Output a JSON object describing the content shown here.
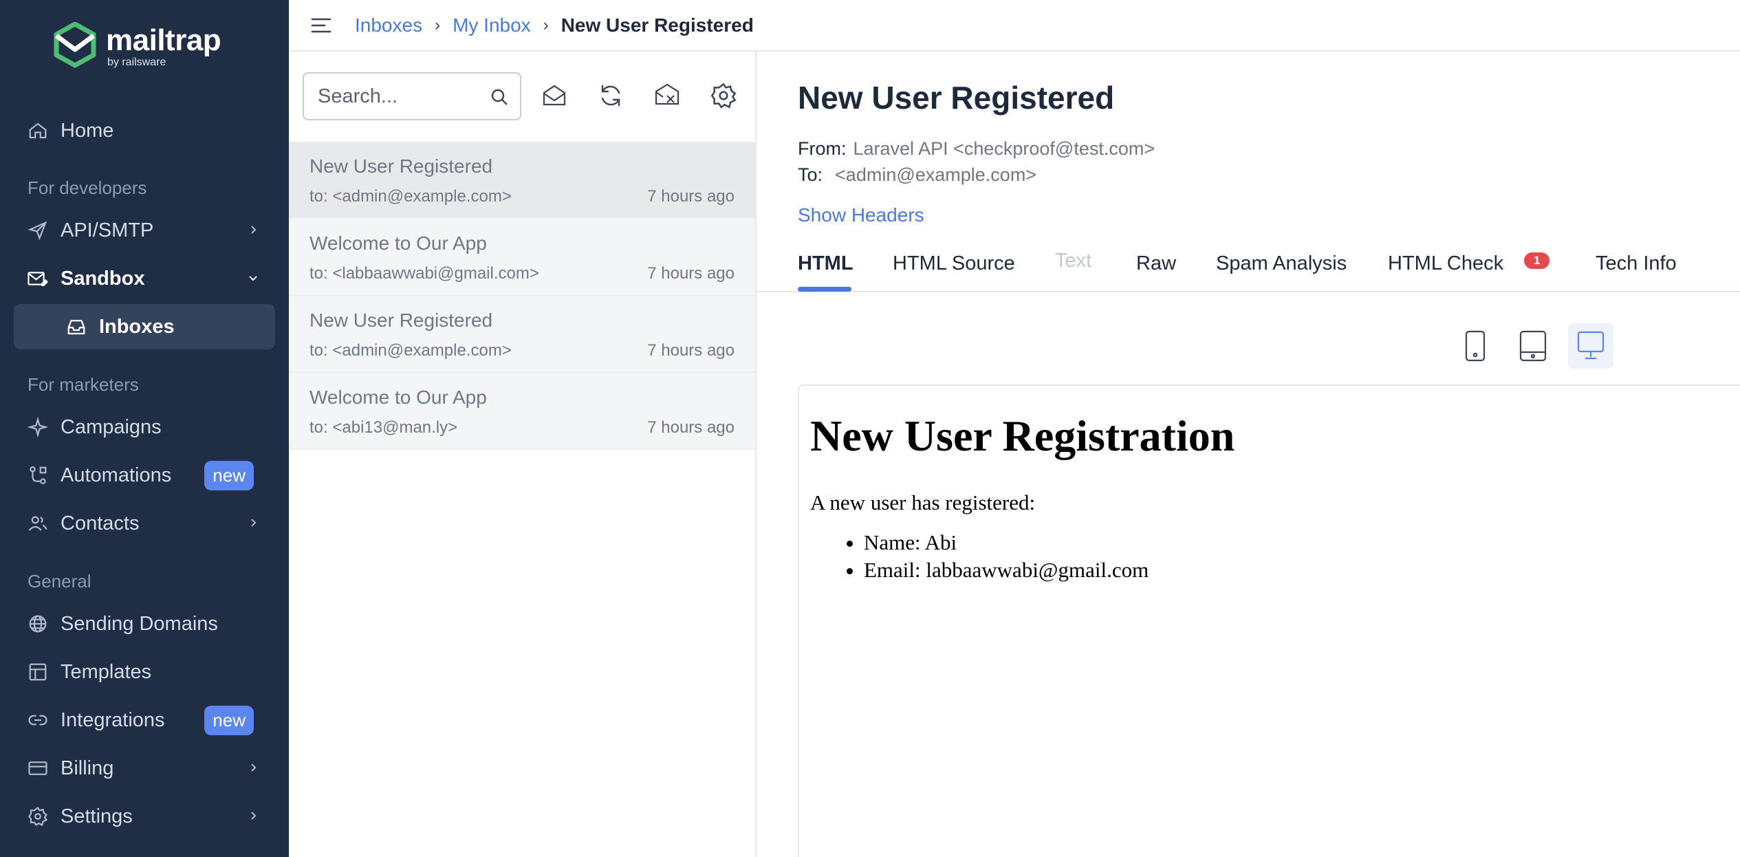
{
  "brand": {
    "name": "mailtrap",
    "sub": "by railsware",
    "accent": "#4dbd74"
  },
  "sidebar": {
    "home": "Home",
    "section_dev": "For developers",
    "api_smtp": "API/SMTP",
    "sandbox": "Sandbox",
    "inboxes": "Inboxes",
    "section_marketers": "For marketers",
    "campaigns": "Campaigns",
    "automations": "Automations",
    "automations_badge": "new",
    "contacts": "Contacts",
    "section_general": "General",
    "sending_domains": "Sending Domains",
    "templates": "Templates",
    "integrations": "Integrations",
    "integrations_badge": "new",
    "billing": "Billing",
    "settings": "Settings"
  },
  "breadcrumb": {
    "root": "Inboxes",
    "inbox": "My Inbox",
    "current": "New User Registered",
    "sep": "›"
  },
  "search": {
    "placeholder": "Search..."
  },
  "messages": [
    {
      "subject": "New User Registered",
      "to": "to: <admin@example.com>",
      "time": "7 hours ago"
    },
    {
      "subject": "Welcome to Our App",
      "to": "to: <labbaawwabi@gmail.com>",
      "time": "7 hours ago"
    },
    {
      "subject": "New User Registered",
      "to": "to: <admin@example.com>",
      "time": "7 hours ago"
    },
    {
      "subject": "Welcome to Our App",
      "to": "to: <abi13@man.ly>",
      "time": "7 hours ago"
    }
  ],
  "detail": {
    "subject": "New User Registered",
    "from_label": "From:",
    "from_value": "Laravel API <checkproof@test.com>",
    "to_label": "To:",
    "to_value": "<admin@example.com>",
    "show_headers": "Show Headers"
  },
  "tabs": {
    "html": "HTML",
    "html_source": "HTML Source",
    "text": "Text",
    "raw": "Raw",
    "spam": "Spam Analysis",
    "html_check": "HTML Check",
    "html_check_badge": "1",
    "tech_info": "Tech Info"
  },
  "email_body": {
    "heading": "New User Registration",
    "intro": "A new user has registered:",
    "name_line": "Name: Abi",
    "email_line": "Email: labbaawwabi@gmail.com"
  }
}
